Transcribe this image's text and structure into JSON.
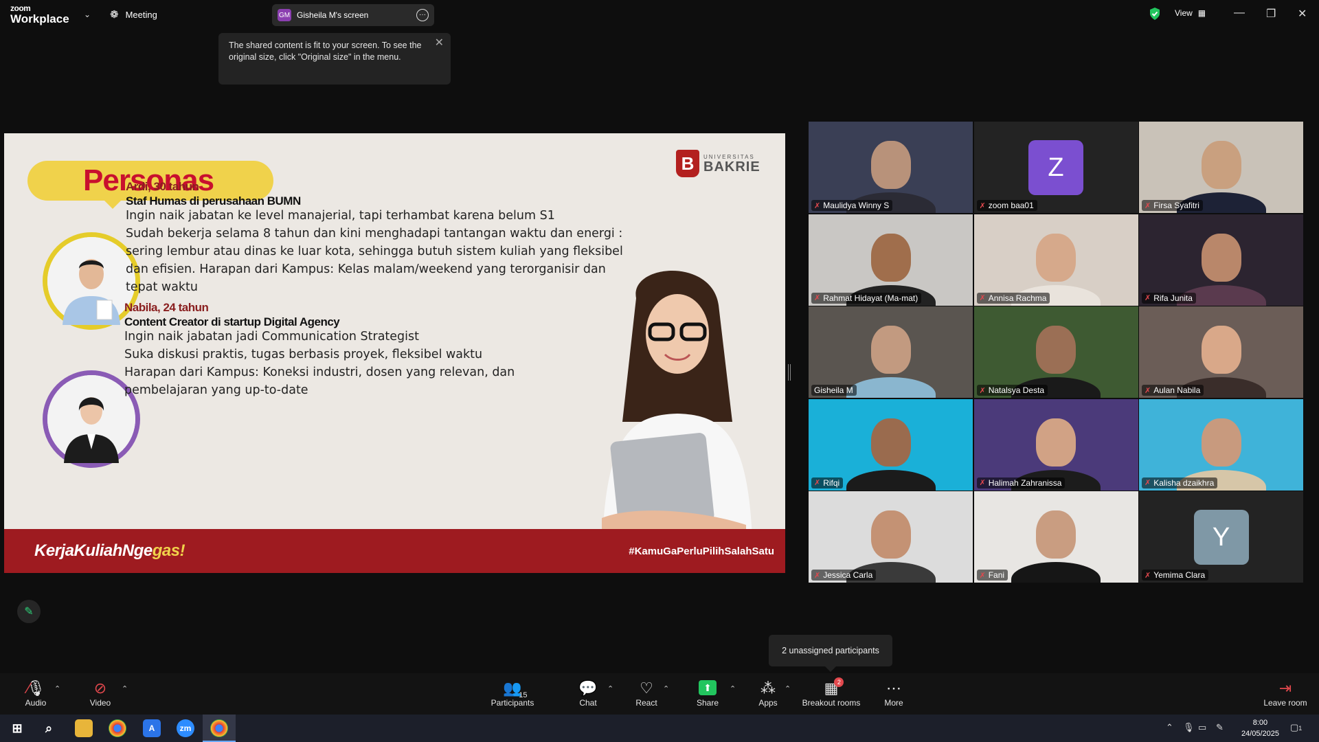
{
  "app": {
    "brand_line1": "zoom",
    "brand_line2": "Workplace",
    "meeting_label": "Meeting",
    "view_label": "View"
  },
  "screen_tab": {
    "initials": "GM",
    "label": "Gisheila M's screen"
  },
  "tooltip": {
    "text": "The shared content is fit to your screen. To see the original size, click \"Original size\" in the menu."
  },
  "slide": {
    "title": "Personas",
    "logo_small": "UNIVERSITAS",
    "logo_big": "BAKRIE",
    "logo_mark": "B",
    "persona1": {
      "name": "Ardi, 30 tahun",
      "role": "Staf Humas di perusahaan BUMN",
      "lines": [
        "Ingin naik jabatan ke level manajerial, tapi terhambat karena belum S1",
        "Sudah bekerja selama 8 tahun dan kini menghadapi tantangan waktu dan energi :",
        "sering lembur atau dinas ke luar kota, sehingga butuh sistem kuliah yang fleksibel",
        "dan efisien. Harapan dari Kampus:  Kelas malam/weekend yang terorganisir dan",
        "tepat waktu"
      ]
    },
    "persona2": {
      "name": "Nabila, 24 tahun",
      "role": "Content Creator di startup Digital Agency",
      "lines": [
        "Ingin naik jabatan jadi Communication Strategist",
        "Suka diskusi praktis, tugas berbasis proyek, fleksibel waktu",
        "Harapan dari Kampus: Koneksi industri, dosen yang relevan, dan",
        "pembelajaran yang up-to-date"
      ]
    },
    "footer_left_a": "KerjaKuliahNge",
    "footer_left_b": "gas!",
    "footer_right": "#KamuGaPerluPilihSalahSatu"
  },
  "participants": [
    {
      "name": "Maulidya Winny S",
      "letter": "",
      "bg": "#3a3f55",
      "skin": "#b8927a",
      "cloth": "#2b2b35"
    },
    {
      "name": "zoom baa01",
      "letter": "Z",
      "bg": "#232323",
      "letter_bg": "#7b4fd0"
    },
    {
      "name": "Firsa Syafitri",
      "letter": "",
      "bg": "#c9c2b8",
      "skin": "#c9a07f",
      "cloth": "#1d2236"
    },
    {
      "name": "Rahmat Hidayat (Ma-mat)",
      "letter": "",
      "bg": "#c9c7c4",
      "skin": "#a06e4c",
      "cloth": "#222"
    },
    {
      "name": "Annisa Rachma",
      "letter": "",
      "bg": "#d8cfc6",
      "skin": "#d6a98b",
      "cloth": "#e9e3dc"
    },
    {
      "name": "Rifa Junita",
      "letter": "",
      "bg": "#2c2430",
      "skin": "#b9876a",
      "cloth": "#5a3a4e"
    },
    {
      "name": "Gisheila M",
      "letter": "",
      "bg": "#5a5550",
      "skin": "#c29a80",
      "cloth": "#8ab6cf",
      "active": true
    },
    {
      "name": "Natalsya Desta",
      "letter": "",
      "bg": "#3e5a32",
      "skin": "#9b6f55",
      "cloth": "#1a1a1a"
    },
    {
      "name": "Aulan Nabila",
      "letter": "",
      "bg": "#6b5d57",
      "skin": "#d9a889",
      "cloth": "#3a2d2a"
    },
    {
      "name": "Rifqi",
      "letter": "",
      "bg": "#1ab0d8",
      "skin": "#9a6b4e",
      "cloth": "#1b1b1b"
    },
    {
      "name": "Halimah Zahranissa",
      "letter": "",
      "bg": "#4b3a7a",
      "skin": "#d1a285",
      "cloth": "#1c1c1c"
    },
    {
      "name": "Kalisha dzaikhra",
      "letter": "",
      "bg": "#3fb3d9",
      "skin": "#c89a7e",
      "cloth": "#d6c6a8"
    },
    {
      "name": "Jessica Carla",
      "letter": "",
      "bg": "#dcdcdc",
      "skin": "#c49274",
      "cloth": "#3a3a3a"
    },
    {
      "name": "Fani",
      "letter": "",
      "bg": "#e8e6e3",
      "skin": "#c99d81",
      "cloth": "#161616"
    },
    {
      "name": "Yemima Clara",
      "letter": "Y",
      "bg": "#232323",
      "letter_bg": "#7f98a6"
    }
  ],
  "unassigned_text": "2 unassigned participants",
  "toolbar": {
    "audio": "Audio",
    "video": "Video",
    "participants": "Participants",
    "participants_count": "15",
    "chat": "Chat",
    "react": "React",
    "share": "Share",
    "apps": "Apps",
    "breakout": "Breakout rooms",
    "breakout_badge": "2",
    "more": "More",
    "leave": "Leave room"
  },
  "taskbar": {
    "time": "8:00",
    "date": "24/05/2025",
    "notif_count": "1"
  }
}
